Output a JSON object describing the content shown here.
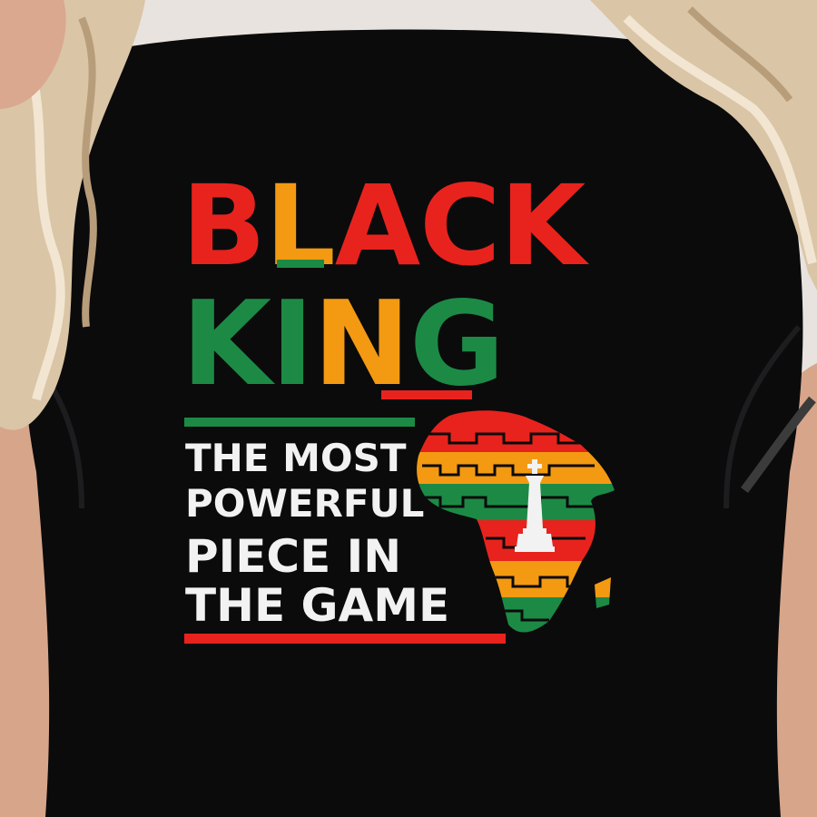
{
  "design": {
    "line1": [
      "B",
      "L",
      "A",
      "C",
      "K"
    ],
    "line2": [
      "K",
      "I",
      "N",
      "G"
    ],
    "tagline": [
      "THE MOST",
      "POWERFUL",
      "PIECE IN",
      "THE GAME"
    ]
  },
  "colors": {
    "shirt": "#0b0b0c",
    "red": "#e8231d",
    "orange": "#f39a12",
    "green": "#1c8a45",
    "white": "#f2f2f2",
    "hair": "#dcc7a8",
    "skin": "#d9a88e"
  },
  "icons": [
    "africa-map-icon",
    "chess-king-icon"
  ]
}
